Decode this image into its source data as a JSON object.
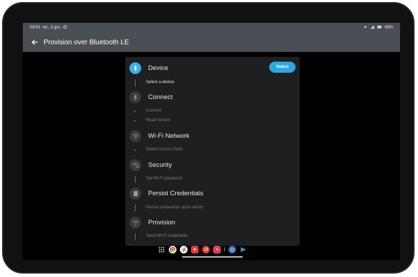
{
  "statusbar": {
    "time": "09:53",
    "date": "wt., 3 gru",
    "battery": "86%"
  },
  "appbar": {
    "title": "Provision over Bluetooth LE"
  },
  "steps": [
    {
      "title": "Device",
      "icon": "bluetooth-icon",
      "subs": [
        "Select a device"
      ],
      "action_label": "Select"
    },
    {
      "title": "Connect",
      "icon": "bluetooth-connect-icon",
      "subs": [
        "Connect",
        "Read version"
      ]
    },
    {
      "title": "Wi-Fi Network",
      "icon": "wifi-network-icon",
      "subs": [
        "Select Access Point"
      ]
    },
    {
      "title": "Security",
      "icon": "wifi-lock-icon",
      "subs": [
        "Set Wi-Fi password"
      ]
    },
    {
      "title": "Persist Credentials",
      "icon": "sd-card-icon",
      "subs": [
        "Persist credentials upon reboot"
      ]
    },
    {
      "title": "Provision",
      "icon": "wifi-icon",
      "subs": [
        "Send Wi-Fi credentials"
      ]
    }
  ],
  "colors": {
    "accent": "#2ea8e0",
    "appbar": "#4a4f55",
    "card": "#1e1f21"
  }
}
